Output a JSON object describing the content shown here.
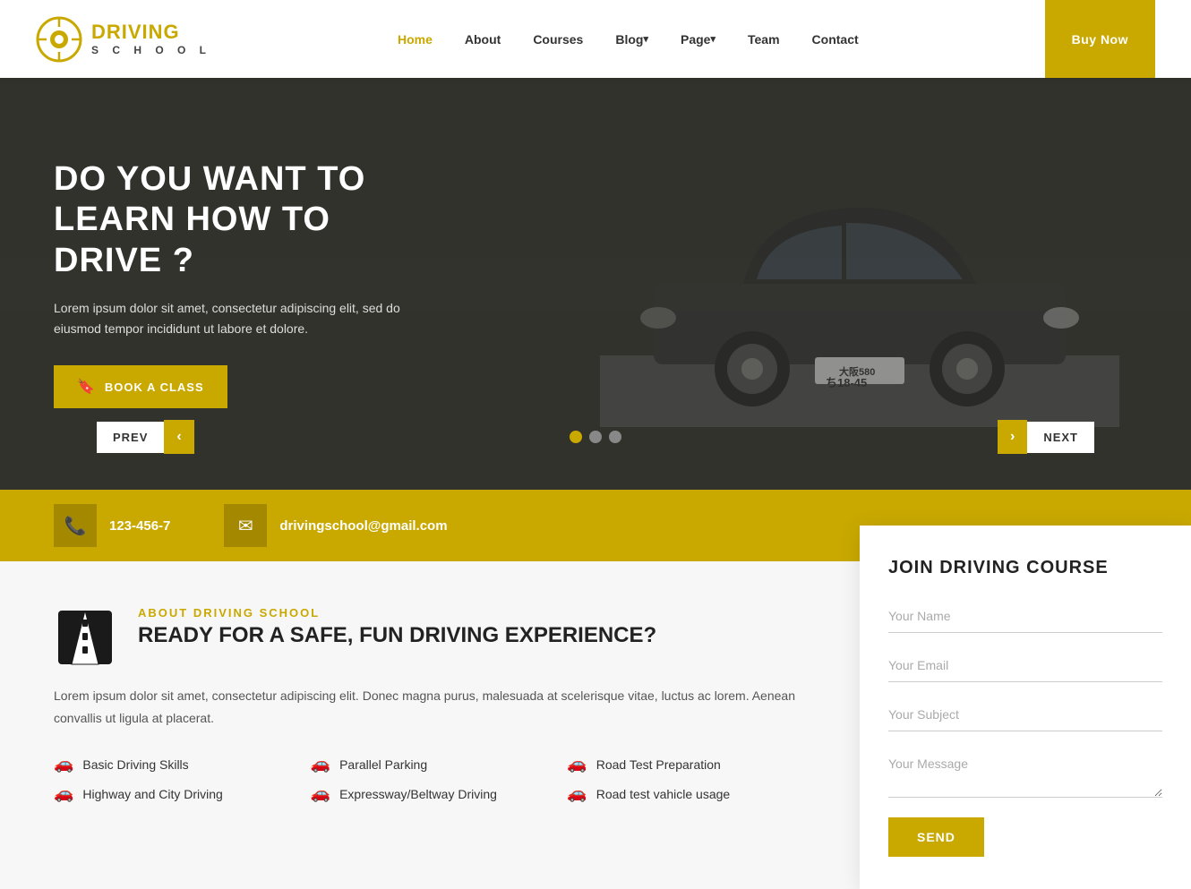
{
  "navbar": {
    "logo_title": "DRIVING",
    "logo_subtitle": "S C H O O L",
    "nav_items": [
      {
        "label": "Home",
        "active": true,
        "has_dropdown": false
      },
      {
        "label": "About",
        "active": false,
        "has_dropdown": false
      },
      {
        "label": "Courses",
        "active": false,
        "has_dropdown": false
      },
      {
        "label": "Blog",
        "active": false,
        "has_dropdown": true
      },
      {
        "label": "Page",
        "active": false,
        "has_dropdown": true
      },
      {
        "label": "Team",
        "active": false,
        "has_dropdown": false
      },
      {
        "label": "Contact",
        "active": false,
        "has_dropdown": false
      }
    ],
    "buy_now_label": "Buy Now"
  },
  "hero": {
    "title_1": "DO YOU WANT TO",
    "title_2": "LEARN HOW TO DRIVE ?",
    "description": "Lorem ipsum dolor sit amet, consectetur adipiscing elit, sed do eiusmod tempor incididunt ut labore et dolore.",
    "book_button": "BOOK A CLASS",
    "prev_label": "PREV",
    "next_label": "NEXT",
    "dots": [
      {
        "active": true
      },
      {
        "active": false
      },
      {
        "active": false
      }
    ]
  },
  "info_bar": {
    "phone": "123-456-7",
    "email": "drivingschool@gmail.com"
  },
  "about": {
    "label": "ABOUT DRIVING SCHOOL",
    "title": "READY FOR A SAFE, FUN DRIVING EXPERIENCE?",
    "description": "Lorem ipsum dolor sit amet, consectetur adipiscing elit. Donec magna purus, malesuada at scelerisque vitae, luctus ac lorem. Aenean convallis ut ligula at placerat.",
    "features": [
      "Basic Driving Skills",
      "Parallel Parking",
      "Road Test Preparation",
      "Highway and City Driving",
      "Expressway/Beltway Driving",
      "Road test vahicle usage"
    ]
  },
  "join_form": {
    "title": "JOIN DRIVING COURSE",
    "name_placeholder": "Your Name",
    "email_placeholder": "Your Email",
    "subject_placeholder": "Your Subject",
    "message_placeholder": "Your Message",
    "send_button": "SEND"
  }
}
